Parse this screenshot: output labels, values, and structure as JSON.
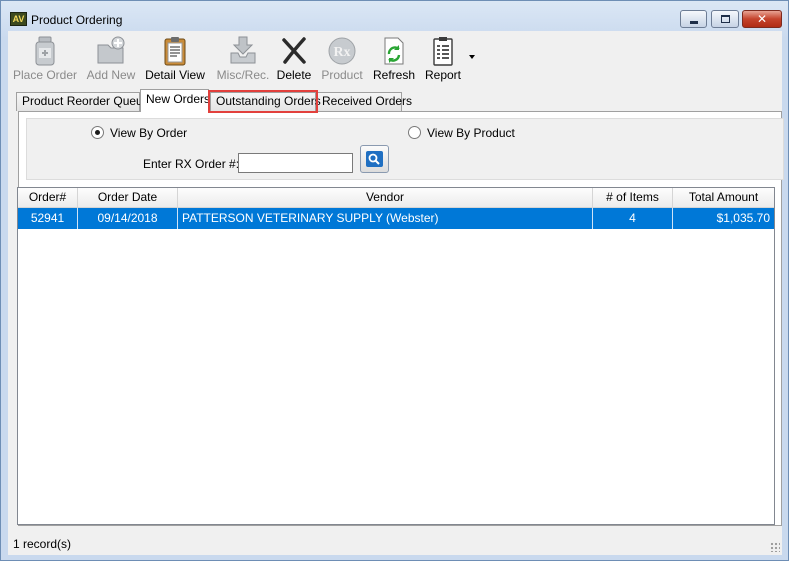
{
  "window": {
    "title": "Product Ordering",
    "app_icon_text": "AV"
  },
  "toolbar": {
    "buttons": [
      {
        "label": "Place Order",
        "icon": "prescription-bottle-icon",
        "enabled": false
      },
      {
        "label": "Add New",
        "icon": "folder-add-icon",
        "enabled": false
      },
      {
        "label": "Detail View",
        "icon": "clipboard-icon",
        "enabled": true
      },
      {
        "label": "Misc/Rec.",
        "icon": "inbox-tray-icon",
        "enabled": false
      },
      {
        "label": "Delete",
        "icon": "delete-x-icon",
        "enabled": true
      },
      {
        "label": "Product",
        "icon": "rx-icon",
        "enabled": false
      },
      {
        "label": "Refresh",
        "icon": "refresh-icon",
        "enabled": true
      },
      {
        "label": "Report",
        "icon": "report-icon",
        "enabled": true
      }
    ]
  },
  "tabs": [
    {
      "label": "Product Reorder Queue"
    },
    {
      "label": "New Orders"
    },
    {
      "label": "Outstanding Orders"
    },
    {
      "label": "Received Orders"
    }
  ],
  "filter": {
    "view_by_order": "View By Order",
    "view_by_product": "View By Product",
    "rx_order_label": "Enter RX Order #:",
    "rx_order_value": ""
  },
  "grid": {
    "columns": [
      "Order#",
      "Order Date",
      "Vendor",
      "# of Items",
      "Total Amount"
    ],
    "rows": [
      {
        "order": "52941",
        "date": "09/14/2018",
        "vendor": "PATTERSON VETERINARY SUPPLY (Webster)",
        "items": "4",
        "total": "$1,035.70"
      }
    ]
  },
  "status": {
    "text": "1 record(s)"
  },
  "colors": {
    "selection": "#0078d7",
    "highlight": "#e2403c"
  }
}
